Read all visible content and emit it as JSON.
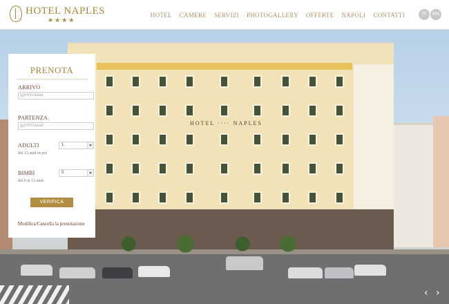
{
  "brand": {
    "name": "HOTEL NAPLES",
    "stars": "★★★★",
    "logo_icon": "hotel-crest-icon"
  },
  "nav": [
    "HOTEL",
    "CAMERE",
    "SERVIZI",
    "PHOTOGALLERY",
    "OFFERTE",
    "NAPOLI",
    "CONTATTI"
  ],
  "lang": {
    "it": "IT",
    "en": "EN"
  },
  "hero": {
    "building_sign": "HOTEL ···· NAPLES"
  },
  "booking": {
    "title": "PRENOTA",
    "arrivo_label": "ARRIVO",
    "arrivo_placeholder": "gg/mm/aaaa",
    "partenza_label": "PARTENZA",
    "partenza_placeholder": "gg/mm/aaaa",
    "adulti_label": "ADULTI",
    "adulti_hint": "dai 13 anni in poi",
    "adulti_value": "1",
    "bimbi_label": "BIMBI",
    "bimbi_hint": "dai 0 ai 12 anni",
    "bimbi_value": "0",
    "verify_label": "VERIFICA",
    "modify_link": "Modifica/Cancella la prenotazione"
  },
  "slider": {
    "prev_icon": "chevron-left-icon",
    "next_icon": "chevron-right-icon"
  },
  "colors": {
    "gold": "#a8883e",
    "button": "#b08d41",
    "label": "#6a3b2c"
  }
}
